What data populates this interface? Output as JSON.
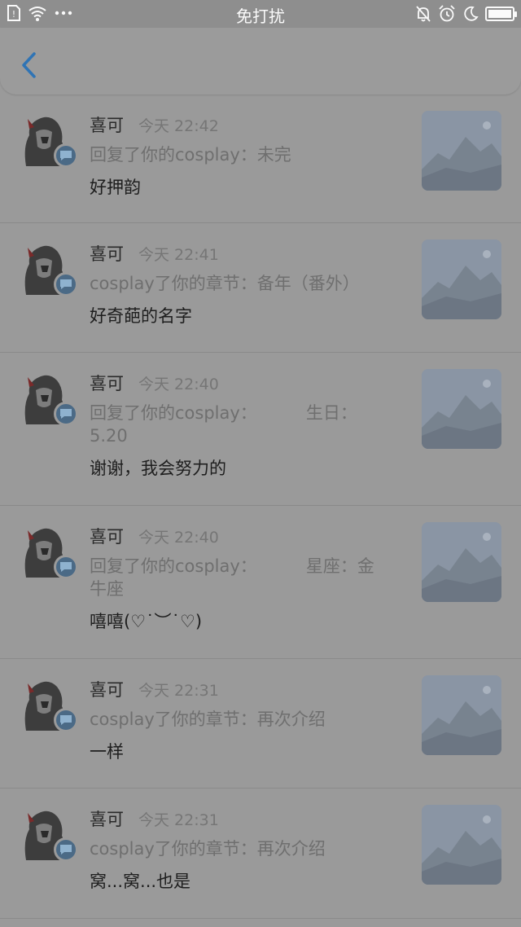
{
  "status_bar": {
    "center_text": "免打扰",
    "left_icons": [
      "sim-icon",
      "wifi-icon",
      "more-dots-icon"
    ],
    "right_icons": [
      "bell-off-icon",
      "alarm-icon",
      "moon-icon",
      "battery-icon"
    ]
  },
  "header": {
    "back_icon": "chevron-left-icon"
  },
  "notifications": [
    {
      "user": "喜可",
      "time": "今天 22:42",
      "action": "回复了你的cosplay：未完",
      "comment": "好押韵"
    },
    {
      "user": "喜可",
      "time": "今天 22:41",
      "action": "cosplay了你的章节：备年（番外）",
      "comment": "好奇葩的名字"
    },
    {
      "user": "喜可",
      "time": "今天 22:40",
      "action": "回复了你的cosplay：         生日：\n5.20",
      "comment": "谢谢，我会努力的"
    },
    {
      "user": "喜可",
      "time": "今天 22:40",
      "action": "回复了你的cosplay：         星座：金\n牛座",
      "comment": "嘻嘻(♡˙︶˙♡)"
    },
    {
      "user": "喜可",
      "time": "今天 22:31",
      "action": "cosplay了你的章节：再次介绍",
      "comment": "一样"
    },
    {
      "user": "喜可",
      "time": "今天 22:31",
      "action": "cosplay了你的章节：再次介绍",
      "comment": "窝...窝...也是"
    }
  ],
  "colors": {
    "accent": "#2f74b5",
    "overlay_bg": "#9a9a9a"
  }
}
